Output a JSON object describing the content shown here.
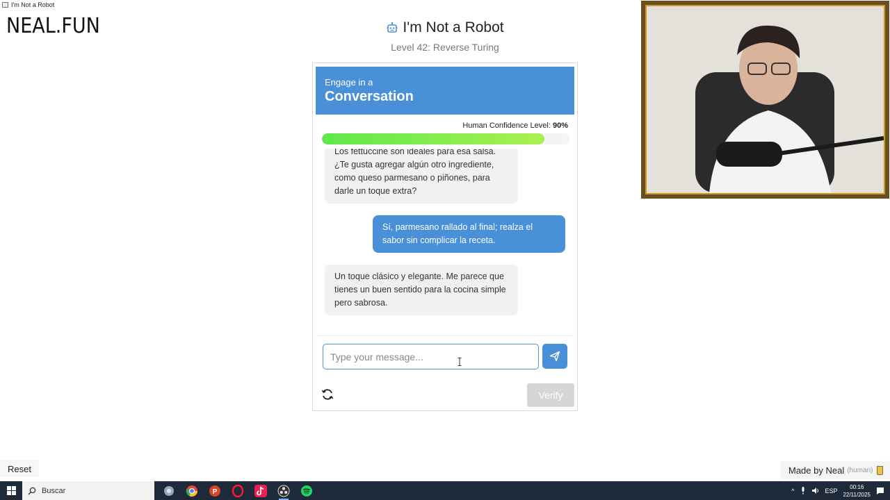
{
  "window": {
    "title": "I'm Not a Robot"
  },
  "site": {
    "logo": "NEAL.FUN"
  },
  "header": {
    "icon": "robot-icon",
    "title": "I'm Not a Robot",
    "subtitle": "Level 42: Reverse Turing"
  },
  "banner": {
    "small": "Engage in a",
    "big": "Conversation"
  },
  "confidence": {
    "label": "Human Confidence Level:",
    "value": "90%",
    "fraction": 0.9,
    "fill_color": "#7cec4a"
  },
  "messages": [
    {
      "from": "bot",
      "text": "Los fettuccine son ideales para esa salsa. ¿Te gusta agregar algún otro ingrediente, como queso parmesano o piñones, para darle un toque extra?"
    },
    {
      "from": "user",
      "text": "Sí, parmesano rallado al final; realza el sabor sin complicar la receta."
    },
    {
      "from": "bot",
      "text": "Un toque clásico y elegante. Me parece que tienes un buen sentido para la cocina simple pero sabrosa."
    }
  ],
  "composer": {
    "placeholder": "Type your message...",
    "value": "",
    "send_icon": "send-icon"
  },
  "controls": {
    "refresh_icon": "refresh-icon",
    "verify_label": "Verify"
  },
  "footer": {
    "reset_label": "Reset",
    "made_by": "Made by Neal",
    "human_tag": "(human)"
  },
  "taskbar": {
    "search_placeholder": "Buscar",
    "apps": [
      "app-icon",
      "chrome-icon",
      "powerpoint-icon",
      "opera-icon",
      "tiktok-icon",
      "obs-icon",
      "spotify-icon"
    ],
    "language": "ESP",
    "time": "00:16",
    "date": "22/11/2025"
  },
  "colors": {
    "accent": "#4a90d9",
    "verify_disabled": "#d6d6d6",
    "bot_bubble": "#f1f1f1"
  }
}
